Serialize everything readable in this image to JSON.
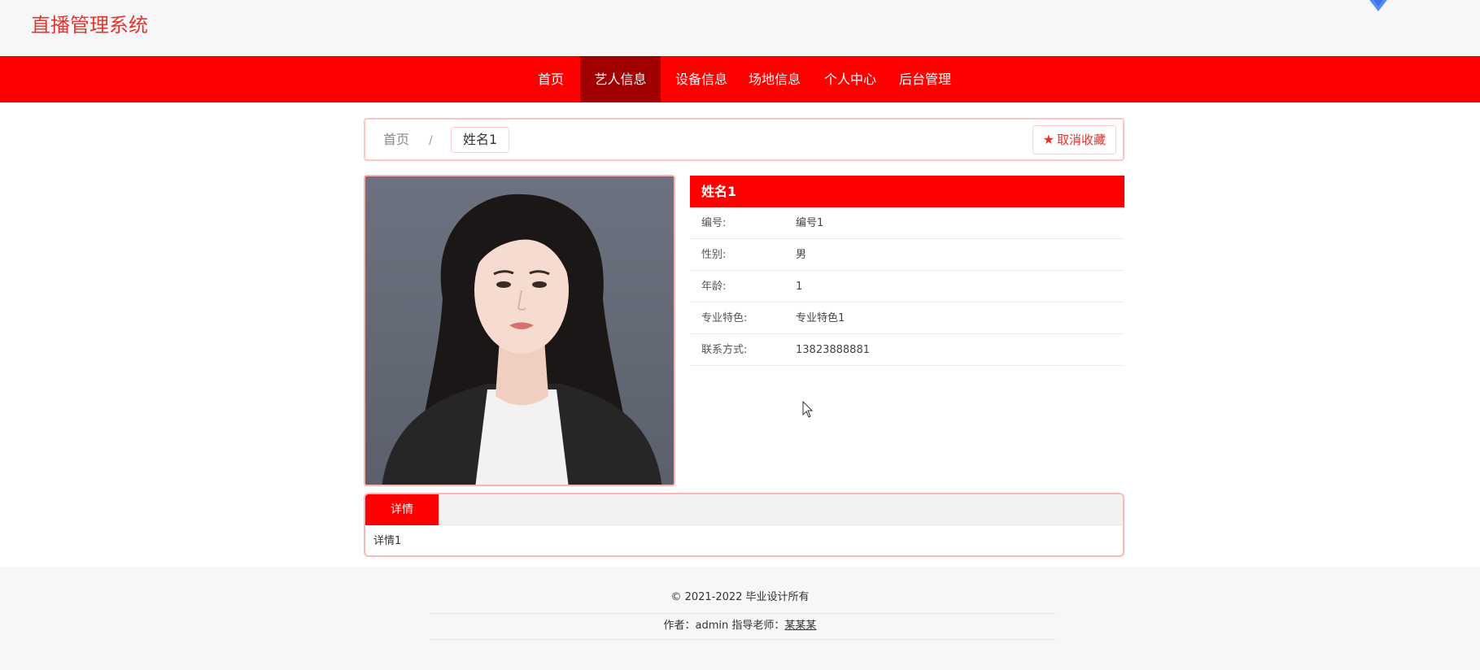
{
  "header": {
    "site_title": "直播管理系统"
  },
  "nav": {
    "items": [
      {
        "label": "首页",
        "active": false
      },
      {
        "label": "艺人信息",
        "active": true
      },
      {
        "label": "设备信息",
        "active": false
      },
      {
        "label": "场地信息",
        "active": false
      },
      {
        "label": "个人中心",
        "active": false
      },
      {
        "label": "后台管理",
        "active": false
      }
    ]
  },
  "breadcrumb": {
    "home": "首页",
    "separator": "/",
    "current": "姓名1",
    "unfavorite_label": "取消收藏",
    "unfavorite_icon": "star-icon"
  },
  "artist": {
    "name": "姓名1",
    "fields": [
      {
        "label": "编号:",
        "value": "编号1"
      },
      {
        "label": "性别:",
        "value": "男"
      },
      {
        "label": "年龄:",
        "value": "1"
      },
      {
        "label": "专业特色:",
        "value": "专业特色1"
      },
      {
        "label": "联系方式:",
        "value": "13823888881"
      }
    ]
  },
  "detail": {
    "tab_label": "详情",
    "content": "详情1"
  },
  "footer": {
    "copyright": "© 2021-2022 毕业设计所有",
    "author_text": "作者：admin 指导老师：",
    "teacher": "某某某"
  },
  "colors": {
    "brand_red": "#ff0000",
    "active_nav": "#a10000",
    "title_red": "#e8322f"
  }
}
